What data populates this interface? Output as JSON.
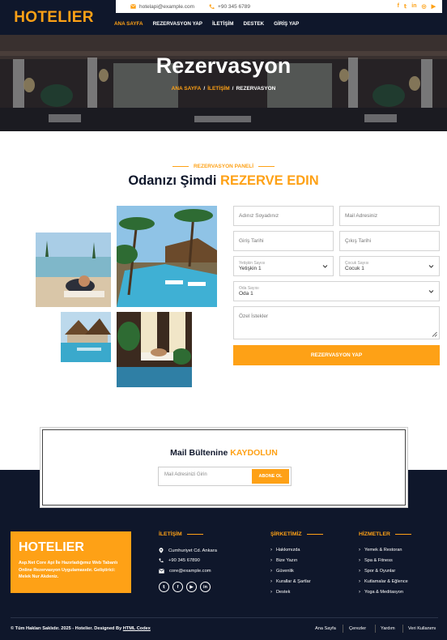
{
  "brand": "HOTELIER",
  "topbar": {
    "email": "hotelapi@example.com",
    "phone": "+90 345 6789",
    "social_icons": [
      "facebook-icon",
      "twitter-icon",
      "linkedin-icon",
      "instagram-icon",
      "youtube-icon"
    ]
  },
  "nav": {
    "items": [
      "ANA SAYFA",
      "REZERVASYON YAP",
      "İLETİŞİM",
      "DESTEK",
      "GİRİŞ YAP"
    ],
    "active": "ANA SAYFA"
  },
  "hero": {
    "title": "Rezervasyon",
    "breadcrumb": [
      "ANA SAYFA",
      "İLETİŞİM",
      "REZERVASYON"
    ]
  },
  "booking": {
    "kicker": "REZERVASYON PANELİ",
    "heading": "Odanızı Şimdi",
    "heading_accent": "REZERVE EDIN",
    "form": {
      "name_placeholder": "Adınız Soyadınız",
      "email_placeholder": "Mail Adresiniz",
      "checkin_placeholder": "Giriş Tarihi",
      "checkout_placeholder": "Çıkış Tarihi",
      "adults_label": "Yetişkin Sayısı",
      "adults_value": "Yetişkin 1",
      "children_label": "Çocuk Sayısı",
      "children_value": "Cocuk 1",
      "room_label": "Oda Sayısı",
      "room_value": "Oda 1",
      "notes_placeholder": "Özel İstekler",
      "submit": "REZERVASYON YAP"
    }
  },
  "newsletter": {
    "title": "Mail Bültenine",
    "title_accent": "KAYDOLUN",
    "placeholder": "Mail Adresinizi Girin",
    "button": "ABONE OL"
  },
  "footer": {
    "brand": "HOTELIER",
    "description": "Asp.Net Core Api İle Hazırladığımız Web Tabanlı Online Rezervasyon Uygulamasıdır. Geliştirici: Melek Nur Akdeniz.",
    "contact_heading": "İLETİŞİM",
    "address": "Cumhuriyet Cd. Ankara",
    "phone": "+90 345 67890",
    "email": "core@example.com",
    "contact_social": [
      "twitter-icon",
      "facebook-icon",
      "youtube-icon",
      "linkedin-icon"
    ],
    "company_heading": "ŞİRKETİMİZ",
    "company_links": [
      "Hakkımızda",
      "Bize Yazın",
      "Güvenlik",
      "Kurallar & Şartlar",
      "Destek"
    ],
    "services_heading": "HİZMETLER",
    "services_links": [
      "Yemek & Restoran",
      "Spa & Fitness",
      "Spor & Oyunlar",
      "Kutlamalar & Eğlence",
      "Yoga & Meditasyon"
    ],
    "copyright": "© Tüm Hakları Saklıdır. 2025 - Hotelier. Designed By",
    "copyright_link": "HTML Codex",
    "bottom_links": [
      "Ana Sayfa",
      "Çerezler",
      "Yardım",
      "Veri Kullanımı"
    ]
  },
  "colors": {
    "accent": "#fea116",
    "dark": "#0f172b"
  }
}
